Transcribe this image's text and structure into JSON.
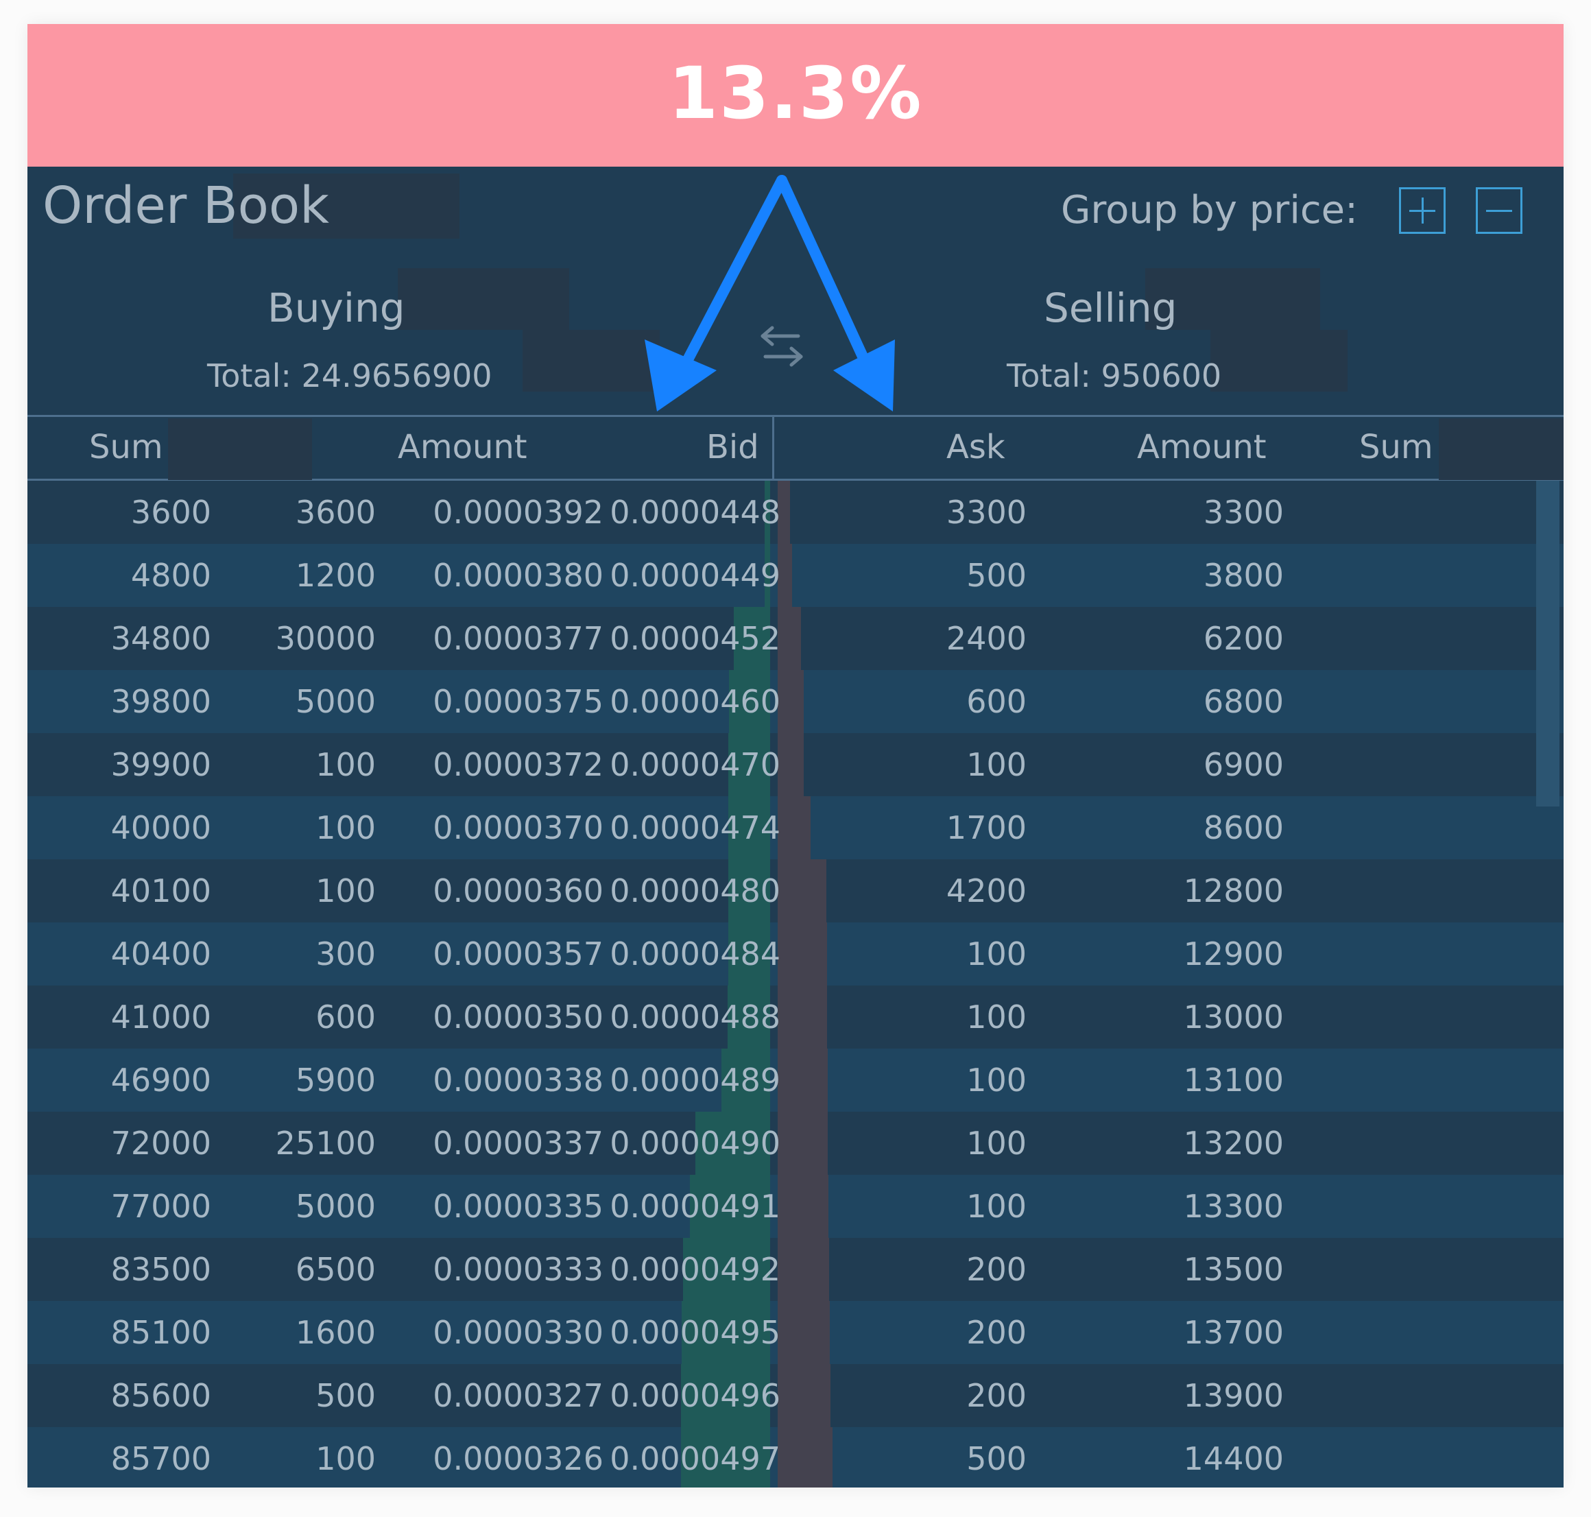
{
  "banner": {
    "percent": "13.3%"
  },
  "orderbook": {
    "title": "Order Book",
    "group_label": "Group by price:",
    "buying": {
      "label": "Buying",
      "total": "Total: 24.9656900"
    },
    "selling": {
      "label": "Selling",
      "total": "Total: 950600"
    },
    "columns": {
      "bid_side": [
        "Sum",
        "Amount",
        "Bid"
      ],
      "ask_side": [
        "Ask",
        "Amount",
        "Sum"
      ]
    },
    "bids": [
      {
        "sum": "3600",
        "amount": "3600",
        "price": "0.0000392"
      },
      {
        "sum": "4800",
        "amount": "1200",
        "price": "0.0000380"
      },
      {
        "sum": "34800",
        "amount": "30000",
        "price": "0.0000377"
      },
      {
        "sum": "39800",
        "amount": "5000",
        "price": "0.0000375"
      },
      {
        "sum": "39900",
        "amount": "100",
        "price": "0.0000372"
      },
      {
        "sum": "40000",
        "amount": "100",
        "price": "0.0000370"
      },
      {
        "sum": "40100",
        "amount": "100",
        "price": "0.0000360"
      },
      {
        "sum": "40400",
        "amount": "300",
        "price": "0.0000357"
      },
      {
        "sum": "41000",
        "amount": "600",
        "price": "0.0000350"
      },
      {
        "sum": "46900",
        "amount": "5900",
        "price": "0.0000338"
      },
      {
        "sum": "72000",
        "amount": "25100",
        "price": "0.0000337"
      },
      {
        "sum": "77000",
        "amount": "5000",
        "price": "0.0000335"
      },
      {
        "sum": "83500",
        "amount": "6500",
        "price": "0.0000333"
      },
      {
        "sum": "85100",
        "amount": "1600",
        "price": "0.0000330"
      },
      {
        "sum": "85600",
        "amount": "500",
        "price": "0.0000327"
      },
      {
        "sum": "85700",
        "amount": "100",
        "price": "0.0000326"
      }
    ],
    "asks": [
      {
        "price": "0.0000448",
        "amount": "3300",
        "sum": "3300"
      },
      {
        "price": "0.0000449",
        "amount": "500",
        "sum": "3800"
      },
      {
        "price": "0.0000452",
        "amount": "2400",
        "sum": "6200"
      },
      {
        "price": "0.0000460",
        "amount": "600",
        "sum": "6800"
      },
      {
        "price": "0.0000470",
        "amount": "100",
        "sum": "6900"
      },
      {
        "price": "0.0000474",
        "amount": "1700",
        "sum": "8600"
      },
      {
        "price": "0.0000480",
        "amount": "4200",
        "sum": "12800"
      },
      {
        "price": "0.0000484",
        "amount": "100",
        "sum": "12900"
      },
      {
        "price": "0.0000488",
        "amount": "100",
        "sum": "13000"
      },
      {
        "price": "0.0000489",
        "amount": "100",
        "sum": "13100"
      },
      {
        "price": "0.0000490",
        "amount": "100",
        "sum": "13200"
      },
      {
        "price": "0.0000491",
        "amount": "100",
        "sum": "13300"
      },
      {
        "price": "0.0000492",
        "amount": "200",
        "sum": "13500"
      },
      {
        "price": "0.0000495",
        "amount": "200",
        "sum": "13700"
      },
      {
        "price": "0.0000496",
        "amount": "200",
        "sum": "13900"
      },
      {
        "price": "0.0000497",
        "amount": "500",
        "sum": "14400"
      }
    ]
  },
  "colors": {
    "banner": "#fc97a3",
    "panel": "#1f3d54",
    "row_alt": "#1f4560",
    "text": "#a7b8c5",
    "accent": "#3d9fd6",
    "bid_depth": "#1f5a58",
    "ask_depth": "#44424f",
    "annotation_arrow": "#1782ff"
  },
  "icons": {
    "plus": "plus-icon",
    "minus": "minus-icon",
    "swap": "swap-arrows-icon",
    "annotation": "arrow-icon"
  }
}
